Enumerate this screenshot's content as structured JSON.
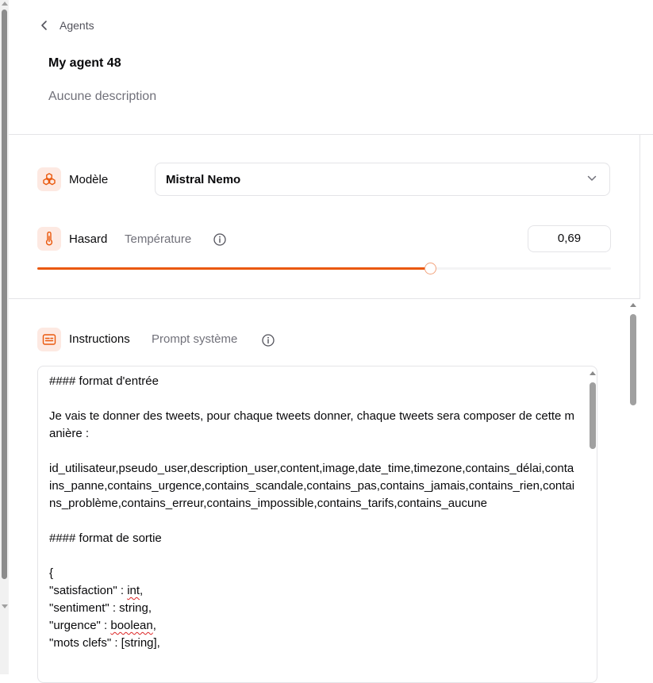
{
  "breadcrumb": {
    "label": "Agents"
  },
  "agent": {
    "name": "My agent 48",
    "description": "Aucune description"
  },
  "model": {
    "label": "Modèle",
    "selected": "Mistral Nemo"
  },
  "randomness": {
    "label": "Hasard",
    "sublabel": "Température",
    "value": "0,69",
    "slider_fraction": 0.685
  },
  "instructions": {
    "label": "Instructions",
    "sublabel": "Prompt système",
    "lines": [
      "#### format d'entrée",
      "",
      "Je vais te donner des tweets, pour chaque tweets donner, chaque tweets sera composer de cette manière :",
      "",
      "id_utilisateur,pseudo_user,description_user,content,image,date_time,timezone,contains_délai,contains_panne,contains_urgence,contains_scandale,contains_pas,contains_jamais,contains_rien,contains_problème,contains_erreur,contains_impossible,contains_tarifs,contains_aucune",
      "",
      "#### format de sortie",
      "",
      "{"
    ],
    "json_lines": [
      {
        "before": "\"satisfaction\" : ",
        "flagged": "int",
        "after": ","
      },
      {
        "before": "\"sentiment\" : string,",
        "flagged": "",
        "after": ""
      },
      {
        "before": "\"urgence\" : ",
        "flagged": "boolean",
        "after": ","
      },
      {
        "before": "\"mots clefs\" : [string],",
        "flagged": "",
        "after": ""
      }
    ]
  },
  "colors": {
    "accent": "#ea580c",
    "icon_bg": "#fde9e2",
    "border": "#e4e4e7"
  },
  "icons": {
    "back": "chevron-left-icon",
    "model": "cubes-icon",
    "temperature": "thermometer-icon",
    "instructions": "text-box-icon",
    "info": "info-circle-icon",
    "dropdown": "chevron-down-icon"
  }
}
